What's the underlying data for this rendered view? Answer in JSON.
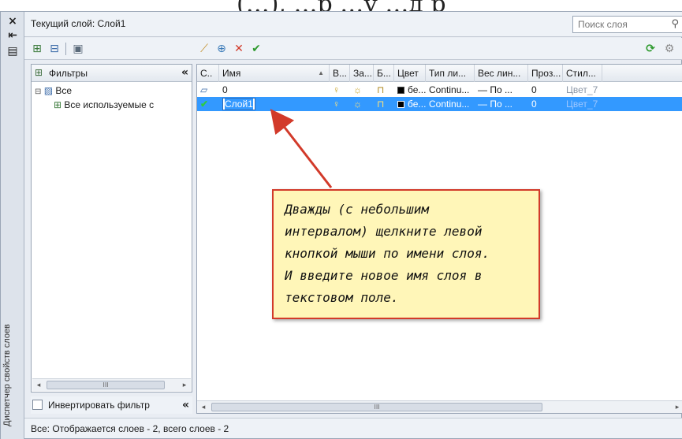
{
  "window": {
    "vertical_title": "Диспетчер свойств слоев",
    "current_layer_label": "Текущий слой: Слой1",
    "search_placeholder": "Поиск слоя"
  },
  "filters": {
    "header": "Фильтры",
    "collapse_glyph": "«",
    "tree": [
      {
        "label": "Все",
        "level": 0
      },
      {
        "label": "Все используемые с",
        "level": 1
      }
    ],
    "invert_label": "Инвертировать фильтр",
    "scroll_thumb": "III"
  },
  "grid": {
    "columns": [
      "С..",
      "Имя",
      "В...",
      "За...",
      "Б...",
      "Цвет",
      "Тип ли...",
      "Вес лин...",
      "Проз...",
      "Стил..."
    ],
    "rows": [
      {
        "status": "▱",
        "name": "0",
        "on": "💡",
        "freeze": "☼",
        "lock": "🔓",
        "color": "бе...",
        "linetype": "Continu...",
        "lineweight": "— По ...",
        "transparency": "0",
        "plotstyle": "Цвет_7",
        "selected": false
      },
      {
        "status": "✔",
        "name": "Слой1",
        "on": "💡",
        "freeze": "☼",
        "lock": "🔓",
        "color": "бе...",
        "linetype": "Continu...",
        "lineweight": "— По ...",
        "transparency": "0",
        "plotstyle": "Цвет_7",
        "selected": true
      }
    ],
    "scroll_thumb": "III"
  },
  "status": "Все: Отображается слоев - 2, всего слоев - 2",
  "callout": {
    "lines": [
      "Дважды (с небольшим",
      "интервалом) щелкните левой",
      "кнопкой мыши по имени слоя.",
      "И введите новое имя слоя в",
      "текстовом поле."
    ]
  },
  "colors": {
    "selection": "#3399ff",
    "callout_bg": "#fff6b8",
    "callout_border": "#d23a2a",
    "arrow": "#d23a2a"
  },
  "icons": {
    "close": "close-icon",
    "autohide": "autohide-icon",
    "properties": "properties-icon",
    "new_filter": "new-property-filter-icon",
    "new_group": "new-group-filter-icon",
    "state_manager": "layer-states-manager-icon",
    "new_layer": "new-layer-icon",
    "new_vp_layer": "new-layer-vp-frozen-icon",
    "delete": "delete-layer-icon",
    "set_current": "set-current-icon",
    "refresh": "refresh-icon",
    "settings": "settings-icon",
    "search": "search-icon"
  }
}
